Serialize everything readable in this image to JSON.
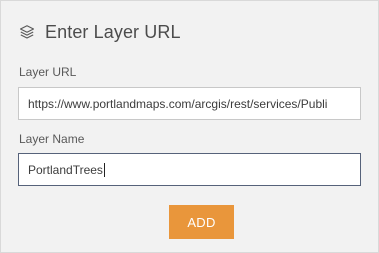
{
  "dialog": {
    "title": "Enter Layer URL",
    "icon": "layers-icon"
  },
  "url_field": {
    "label": "Layer URL",
    "value": "https://www.portlandmaps.com/arcgis/rest/services/Publi"
  },
  "name_field": {
    "label": "Layer Name",
    "value": "PortlandTrees"
  },
  "add_button": {
    "label": "ADD",
    "color": "#e9963b"
  },
  "colors": {
    "panel_background": "#f2f2f2",
    "text": "#4c4c4c",
    "focused_border": "#56627a"
  }
}
